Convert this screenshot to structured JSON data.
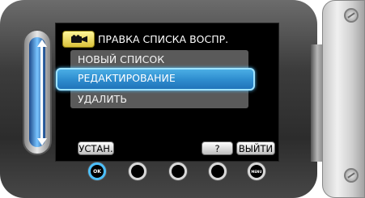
{
  "screen": {
    "title": "ПРАВКА СПИСКА ВОСПР.",
    "title_icon": "video-camera-icon",
    "menu_items": [
      {
        "label": "НОВЫЙ СПИСОК",
        "selected": false
      },
      {
        "label": "РЕДАКТИРОВАНИЕ",
        "selected": true
      },
      {
        "label": "УДАЛИТЬ",
        "selected": false
      }
    ],
    "soft_buttons": {
      "set": "УСТАН.",
      "help": "?",
      "exit": "ВЫЙТИ"
    }
  },
  "hardware_buttons": {
    "ok": "OK",
    "menu": "MENU"
  },
  "colors": {
    "selection": "#2f8ed0",
    "selection_outline": "#9fe3ff",
    "title_icon": "#f2e15a",
    "screen": "#000000"
  }
}
